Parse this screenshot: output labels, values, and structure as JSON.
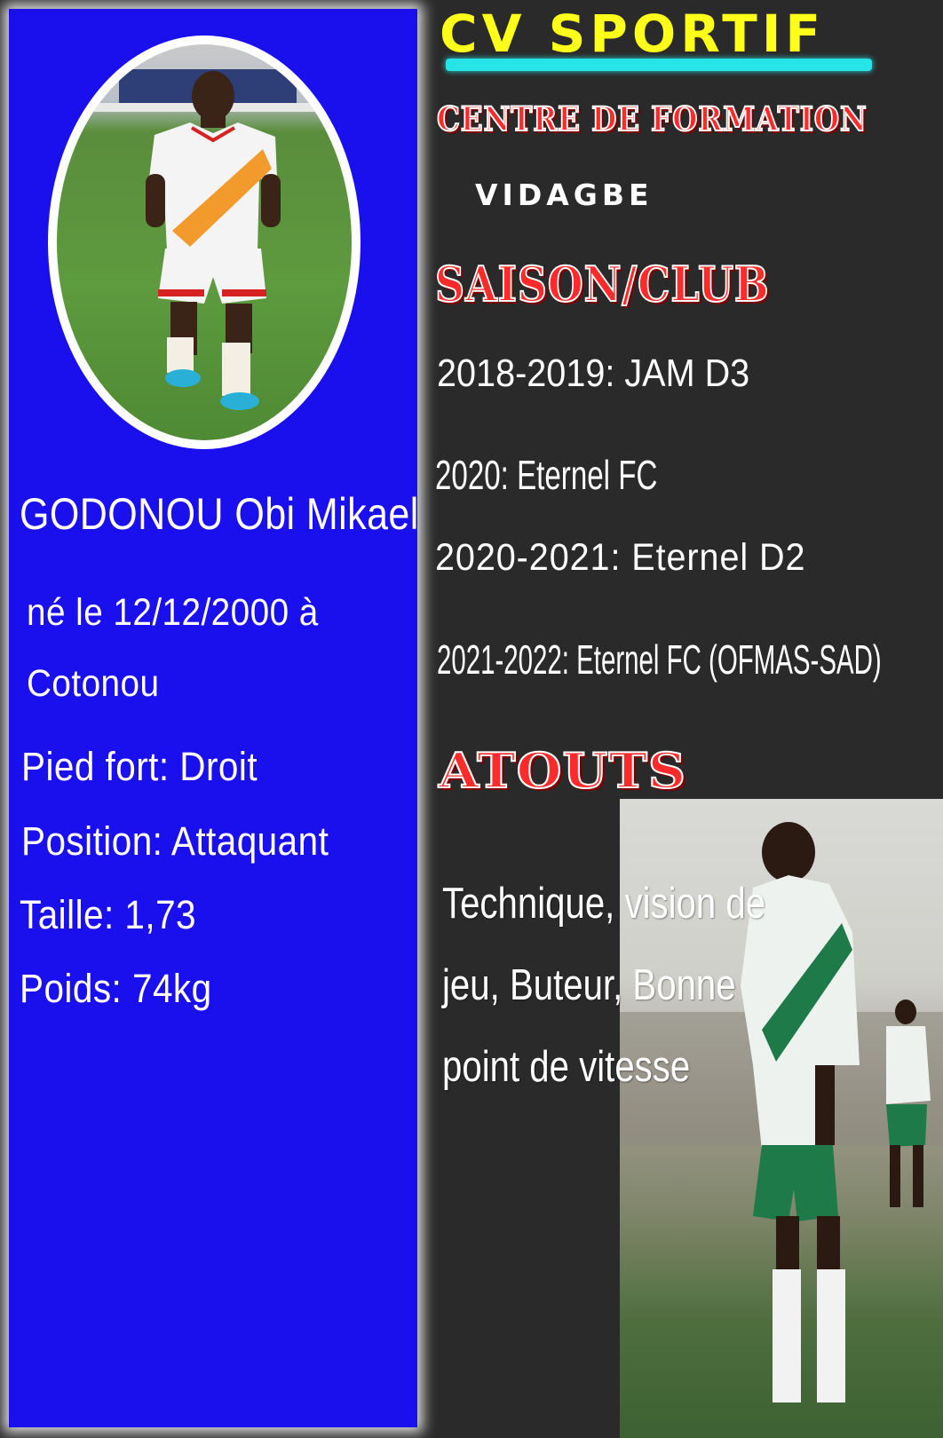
{
  "colors": {
    "left_panel": "#1a10ee",
    "right_panel": "#2a2a2a",
    "title": "#ffff1a",
    "title_bar": "#27e4e6",
    "heading_red": "#ff2a2a",
    "text": "#ffffff"
  },
  "header": {
    "title": "CV SPORTIF"
  },
  "player": {
    "name": "GODONOU Obi Mikael",
    "birth_line1": "né le 12/12/2000 à",
    "birth_line2": "Cotonou",
    "strong_foot": "Pied fort: Droit",
    "position": "Position: Attaquant",
    "height": "Taille: 1,73",
    "weight": "Poids: 74kg"
  },
  "training": {
    "heading": "CENTRE DE FORMATION",
    "name": "VIDAGBE"
  },
  "clubs": {
    "heading": "SAISON/CLUB",
    "items": [
      "2018-2019: JAM D3",
      "2020: Eternel FC",
      "2020-2021: Eternel D2",
      "2021-2022: Eternel FC (OFMAS-SAD)"
    ]
  },
  "atouts": {
    "heading": "ATOUTS",
    "lines": [
      "Technique, vision de",
      "jeu, Buteur, Bonne",
      "point de vitesse"
    ]
  }
}
